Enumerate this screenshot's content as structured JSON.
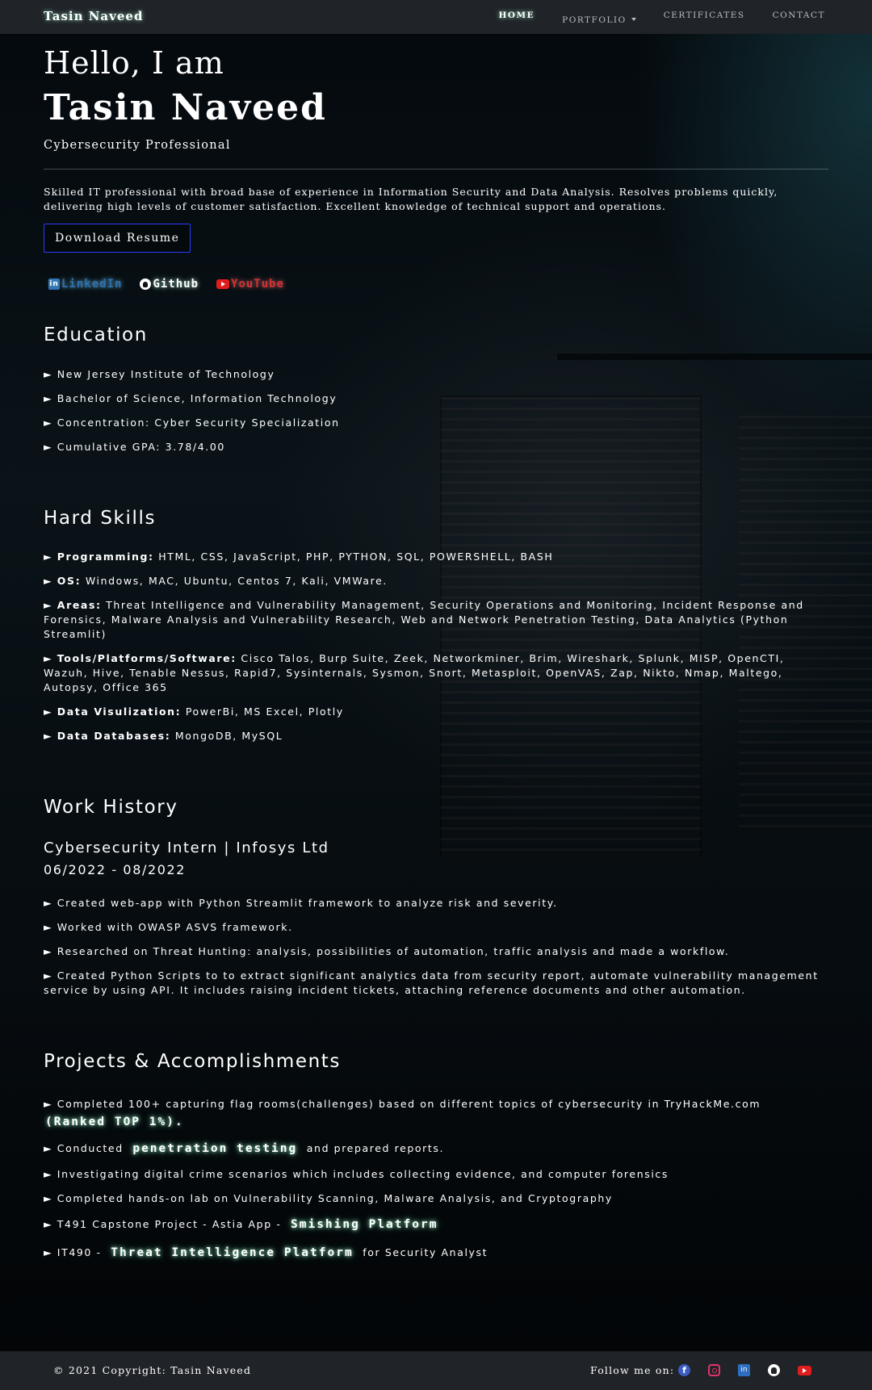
{
  "nav": {
    "brand": "Tasin Naveed",
    "links": [
      "HOME",
      "PORTFOLIO",
      "CERTIFICATES",
      "CONTACT"
    ]
  },
  "hero": {
    "greeting": "Hello, I am",
    "name": "Tasin Naveed",
    "role": "Cybersecurity Professional",
    "intro": "Skilled IT professional with broad base of experience in Information Security and Data Analysis. Resolves problems quickly, delivering high levels of customer satisfaction. Excellent knowledge of technical support and operations.",
    "resume_button": "Download Resume"
  },
  "socials": {
    "linkedin": "LinkedIn",
    "github": "Github",
    "youtube": "YouTube"
  },
  "bullet_marker": "►",
  "education": {
    "heading": "Education",
    "items": [
      "New Jersey Institute of Technology",
      "Bachelor of Science, Information Technology",
      "Concentration: Cyber Security Specialization",
      "Cumulative GPA: 3.78/4.00"
    ]
  },
  "skills": {
    "heading": "Hard Skills",
    "items": [
      {
        "label": "Programming:",
        "text": "HTML, CSS, JavaScript, PHP, PYTHON, SQL, POWERSHELL, BASH"
      },
      {
        "label": "OS:",
        "text": "Windows, MAC, Ubuntu, Centos 7, Kali, VMWare."
      },
      {
        "label": "Areas:",
        "text": "Threat Intelligence and Vulnerability Management, Security Operations and Monitoring, Incident Response and Forensics, Malware Analysis and Vulnerability Research, Web and Network Penetration Testing, Data Analytics (Python Streamlit)"
      },
      {
        "label": "Tools/Platforms/Software:",
        "text": "Cisco Talos, Burp Suite, Zeek, Networkminer, Brim, Wireshark, Splunk, MISP, OpenCTI, Wazuh, Hive, Tenable Nessus, Rapid7, Sysinternals, Sysmon, Snort, Metasploit, OpenVAS, Zap, Nikto, Nmap, Maltego, Autopsy, Office 365"
      },
      {
        "label": "Data Visulization:",
        "text": "PowerBi, MS Excel, Plotly"
      },
      {
        "label": "Data Databases:",
        "text": "MongoDB, MySQL"
      }
    ]
  },
  "work": {
    "heading": "Work History",
    "job_title": "Cybersecurity Intern | Infosys Ltd",
    "dates": "06/2022 - 08/2022",
    "items": [
      "Created web-app with Python Streamlit framework to analyze risk and severity.",
      "Worked with OWASP ASVS framework.",
      "Researched on Threat Hunting: analysis, possibilities of automation, traffic analysis and made a workflow.",
      "Created Python Scripts to to extract significant analytics data from security report, automate vulnerability management service by using API. It includes raising incident tickets, attaching reference documents and other automation."
    ]
  },
  "projects": {
    "heading": "Projects & Accomplishments",
    "items": [
      {
        "pre": "Completed 100+ capturing flag rooms(challenges) based on different topics of cybersecurity in TryHackMe.com",
        "glow": "(Ranked TOP 1%).",
        "post": ""
      },
      {
        "pre": "Conducted",
        "glow": "penetration testing",
        "post": "and prepared reports."
      },
      {
        "pre": "Investigating digital crime scenarios which includes collecting evidence, and computer forensics",
        "glow": "",
        "post": ""
      },
      {
        "pre": "Completed hands-on lab on Vulnerability Scanning, Malware Analysis, and Cryptography",
        "glow": "",
        "post": ""
      },
      {
        "pre": "T491 Capstone Project - Astia App -",
        "glow": "Smishing Platform",
        "post": ""
      },
      {
        "pre": "IT490 -",
        "glow": "Threat Intelligence Platform",
        "post": "for Security Analyst"
      }
    ]
  },
  "footer": {
    "copyright": "© 2021 Copyright: Tasin Naveed",
    "follow": "Follow me on:",
    "icons": [
      "facebook-icon",
      "instagram-icon",
      "linkedin-icon",
      "github-icon",
      "youtube-icon"
    ]
  },
  "colors": {
    "nav_bg": "#202327",
    "glow": "#aaffd2",
    "button_border": "#2a3cff",
    "linkedin": "#2f6fb0",
    "youtube": "#e11d1d",
    "instagram": "#e2336a",
    "facebook": "#3b5ec4"
  }
}
